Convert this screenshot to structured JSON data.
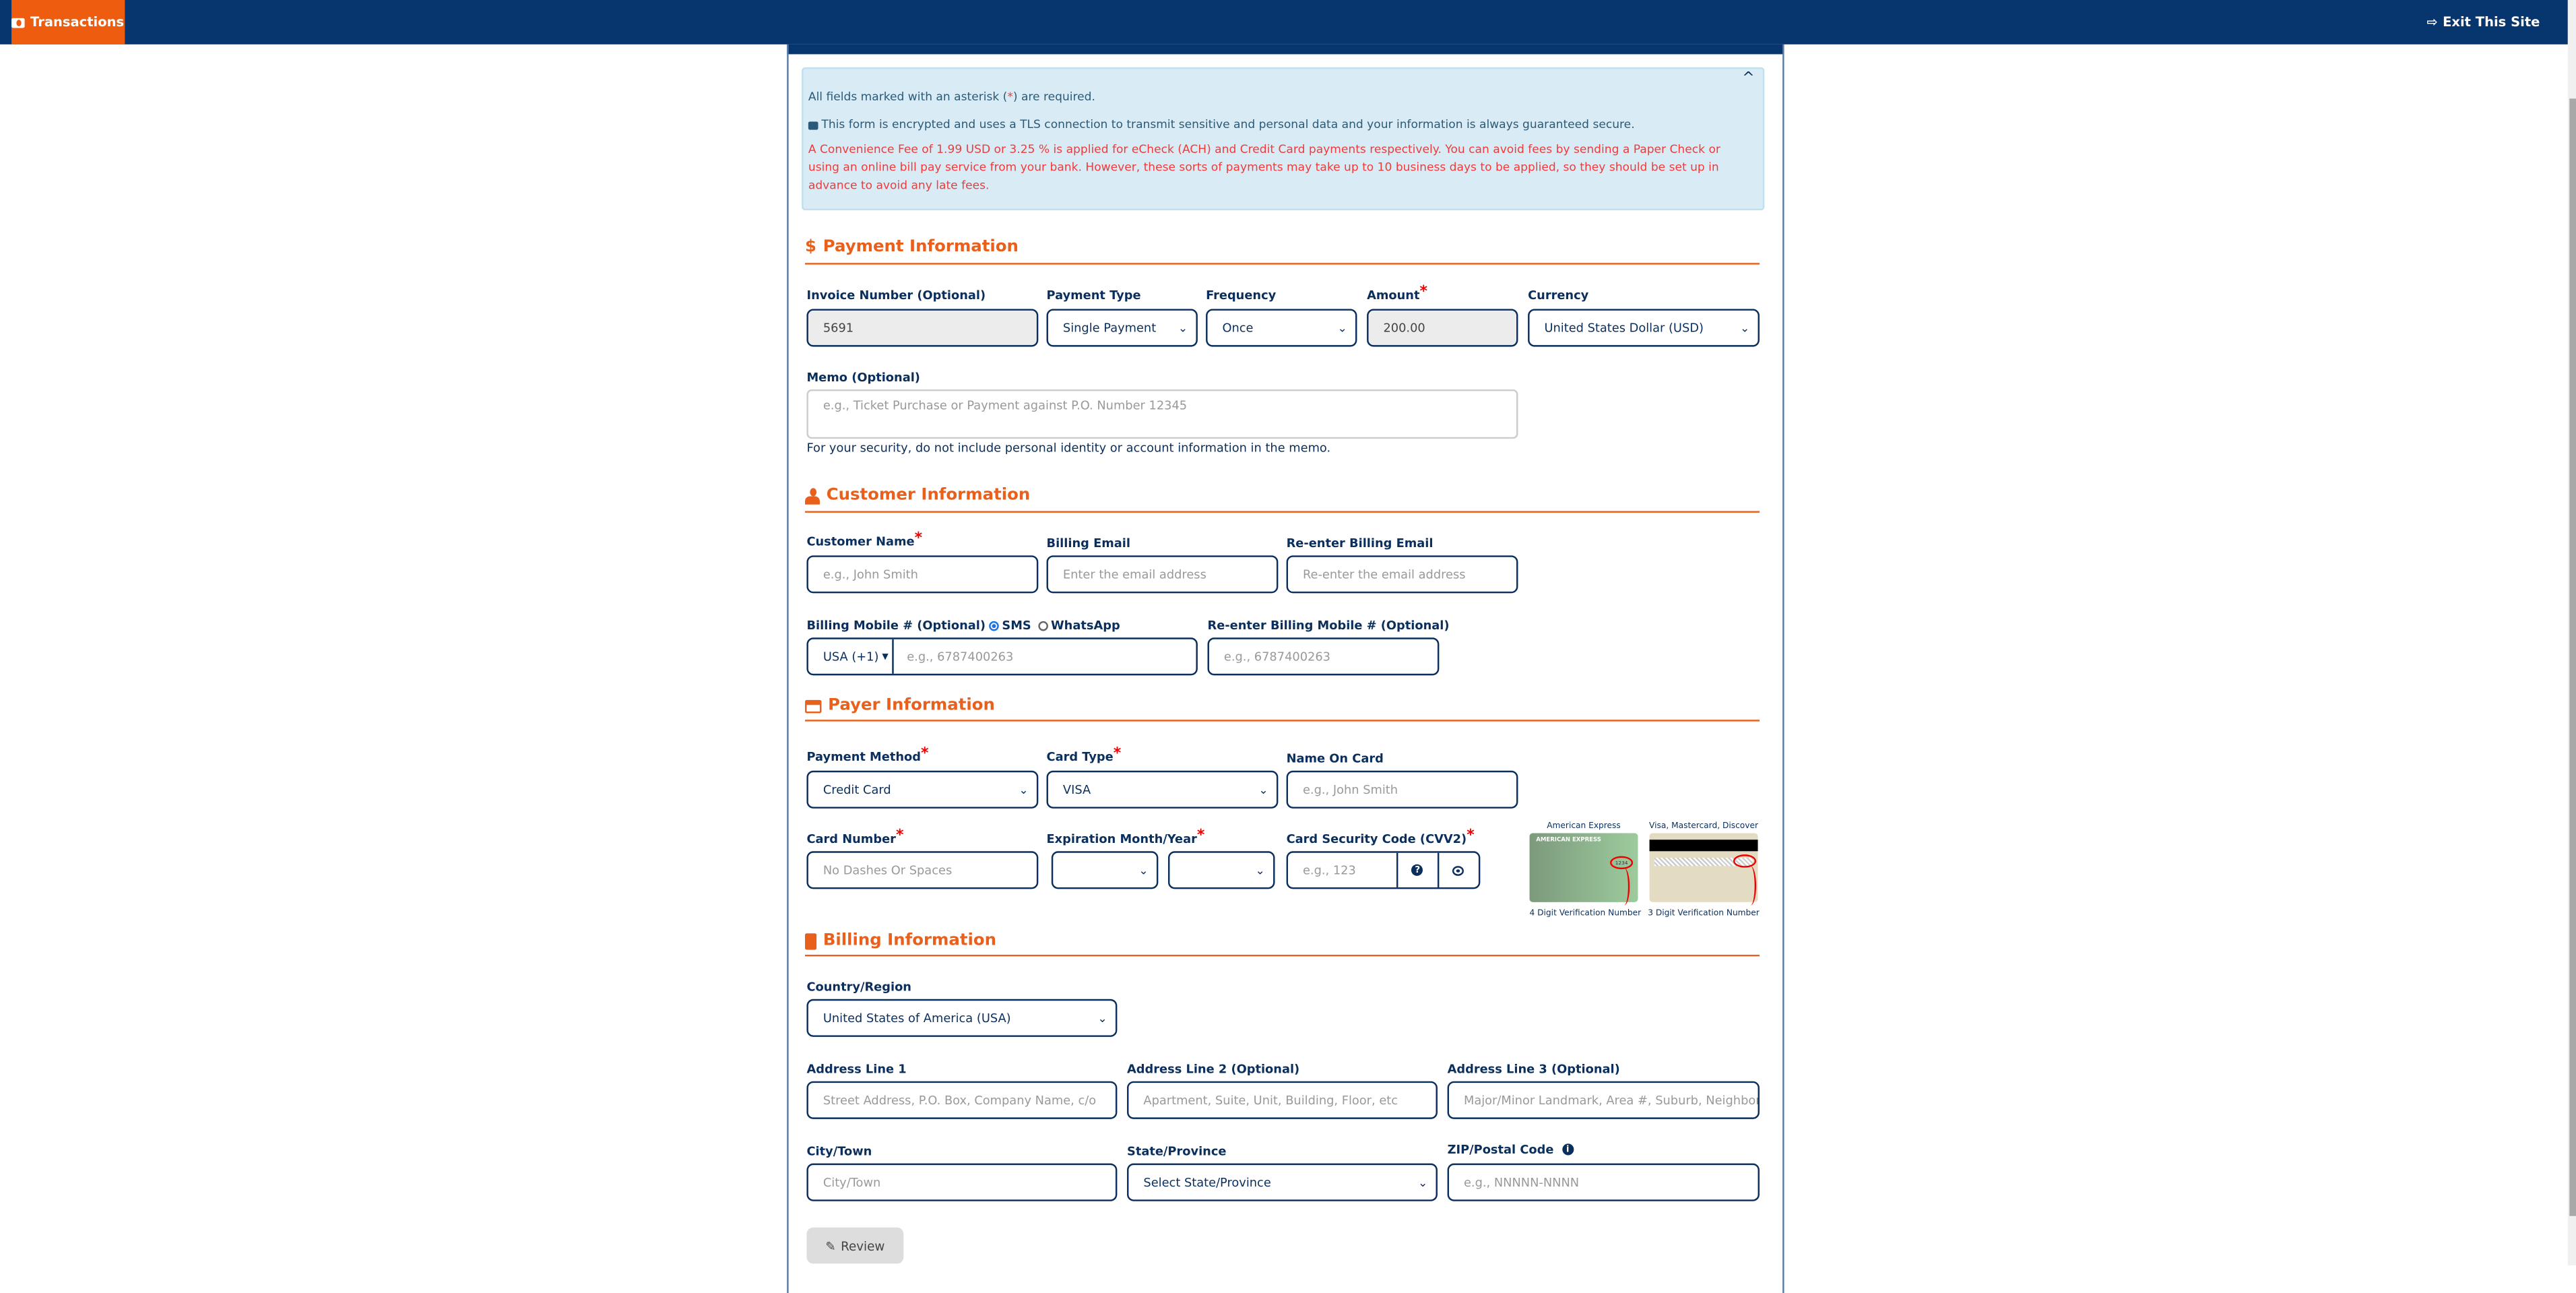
{
  "nav": {
    "transactions_label": "Transactions",
    "exit_label": "Exit This Site"
  },
  "alert": {
    "required_pre": "All fields marked with an asterisk (",
    "required_star": "*",
    "required_post": ") are required.",
    "secure_text": "This form is encrypted and uses a TLS connection to transmit sensitive and personal data and your information is always guaranteed secure.",
    "fee_text": "A Convenience Fee of 1.99 USD or 3.25 % is applied for eCheck (ACH) and Credit Card payments respectively. You can avoid fees by sending a Paper Check or using an online bill pay service from your bank. However, these sorts of payments may take up to 10 business days to be applied, so they should be set up in advance to avoid any late fees."
  },
  "payment": {
    "heading": "Payment Information",
    "invoice_label": "Invoice Number (Optional)",
    "invoice_value": "5691",
    "type_label": "Payment Type",
    "type_value": "Single Payment",
    "frequency_label": "Frequency",
    "frequency_value": "Once",
    "amount_label": "Amount",
    "amount_value": "200.00",
    "currency_label": "Currency",
    "currency_value": "United States Dollar (USD)",
    "memo_label": "Memo (Optional)",
    "memo_placeholder": "e.g., Ticket Purchase or Payment against P.O. Number 12345",
    "memo_note": "For your security, do not include personal identity or account information in the memo."
  },
  "customer": {
    "heading": "Customer Information",
    "name_label": "Customer Name",
    "name_placeholder": "e.g., John Smith",
    "email_label": "Billing Email",
    "email_placeholder": "Enter the email address",
    "reemail_label": "Re-enter Billing Email",
    "reemail_placeholder": "Re-enter the email address",
    "mobile_label": "Billing Mobile # (Optional)",
    "sms_label": "SMS",
    "whatsapp_label": "WhatsApp",
    "country_code": "USA (+1)",
    "mobile_placeholder": "e.g., 6787400263",
    "remobile_label": "Re-enter Billing Mobile # (Optional)",
    "remobile_placeholder": "e.g., 6787400263"
  },
  "payer": {
    "heading": "Payer Information",
    "method_label": "Payment Method",
    "method_value": "Credit Card",
    "cardtype_label": "Card Type",
    "cardtype_value": "VISA",
    "nameoncard_label": "Name On Card",
    "nameoncard_placeholder": "e.g., John Smith",
    "cardnum_label": "Card Number",
    "cardnum_placeholder": "No Dashes Or Spaces",
    "expiry_label": "Expiration Month/Year",
    "cvv_label": "Card Security Code (CVV2)",
    "cvv_placeholder": "e.g., 123",
    "amex_title": "American Express",
    "amex_caption": "4 Digit Verification Number",
    "amex_card_text": "AMERICAN EXPRESS",
    "amex_code": "1234",
    "visa_title": "Visa, Mastercard, Discover",
    "visa_caption": "3 Digit Verification Number"
  },
  "billing": {
    "heading": "Billing Information",
    "country_label": "Country/Region",
    "country_value": "United States of America (USA)",
    "addr1_label": "Address Line 1",
    "addr1_placeholder": "Street Address, P.O. Box, Company Name, c/o",
    "addr2_label": "Address Line 2 (Optional)",
    "addr2_placeholder": "Apartment, Suite, Unit, Building, Floor, etc",
    "addr3_label": "Address Line 3 (Optional)",
    "addr3_placeholder": "Major/Minor Landmark, Area #, Suburb, Neighborhood",
    "city_label": "City/Town",
    "city_placeholder": "City/Town",
    "state_label": "State/Province",
    "state_value": "Select State/Province",
    "zip_label": "ZIP/Postal Code",
    "zip_placeholder": "e.g., NNNNN-NNNN"
  },
  "actions": {
    "review_label": "Review"
  },
  "colors": {
    "nav": "#07366f",
    "accent": "#ee5d0f",
    "alert_bg": "#d9ecf5",
    "fee_text": "#ef3b3b"
  }
}
